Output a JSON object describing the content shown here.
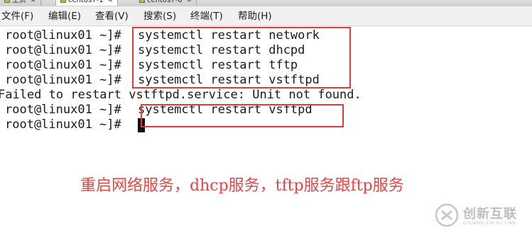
{
  "tabs": [
    {
      "label": "主页"
    },
    {
      "label": "centos7-1",
      "active": true
    },
    {
      "label": "centos7-0"
    }
  ],
  "menu": [
    {
      "label": "文件(F)"
    },
    {
      "label": "编辑(E)"
    },
    {
      "label": "查看(V)"
    },
    {
      "label": "搜索(S)"
    },
    {
      "label": "终端(T)"
    },
    {
      "label": "帮助(H)"
    }
  ],
  "terminal": {
    "prompt": "root@linux01 ~]#",
    "lines": [
      {
        "type": "command",
        "cmd": "systemctl restart network"
      },
      {
        "type": "command",
        "cmd": "systemctl restart dhcpd"
      },
      {
        "type": "command",
        "cmd": "systemctl restart tftp"
      },
      {
        "type": "command",
        "cmd": "systemctl restart vstftpd"
      },
      {
        "type": "output",
        "text": "Failed to restart vstftpd.service: Unit not found."
      },
      {
        "type": "command",
        "cmd": "systemctl restart vsftpd"
      },
      {
        "type": "command",
        "cmd": ""
      }
    ]
  },
  "annotation": {
    "text": "重启网络服务，dhcp服务，tftp服务跟ftp服务",
    "color": "#e04848"
  },
  "highlight_color": "#e03b3b",
  "watermark": {
    "title": "创新互联",
    "subtitle": "CHUANG XIN HU LIAN"
  }
}
